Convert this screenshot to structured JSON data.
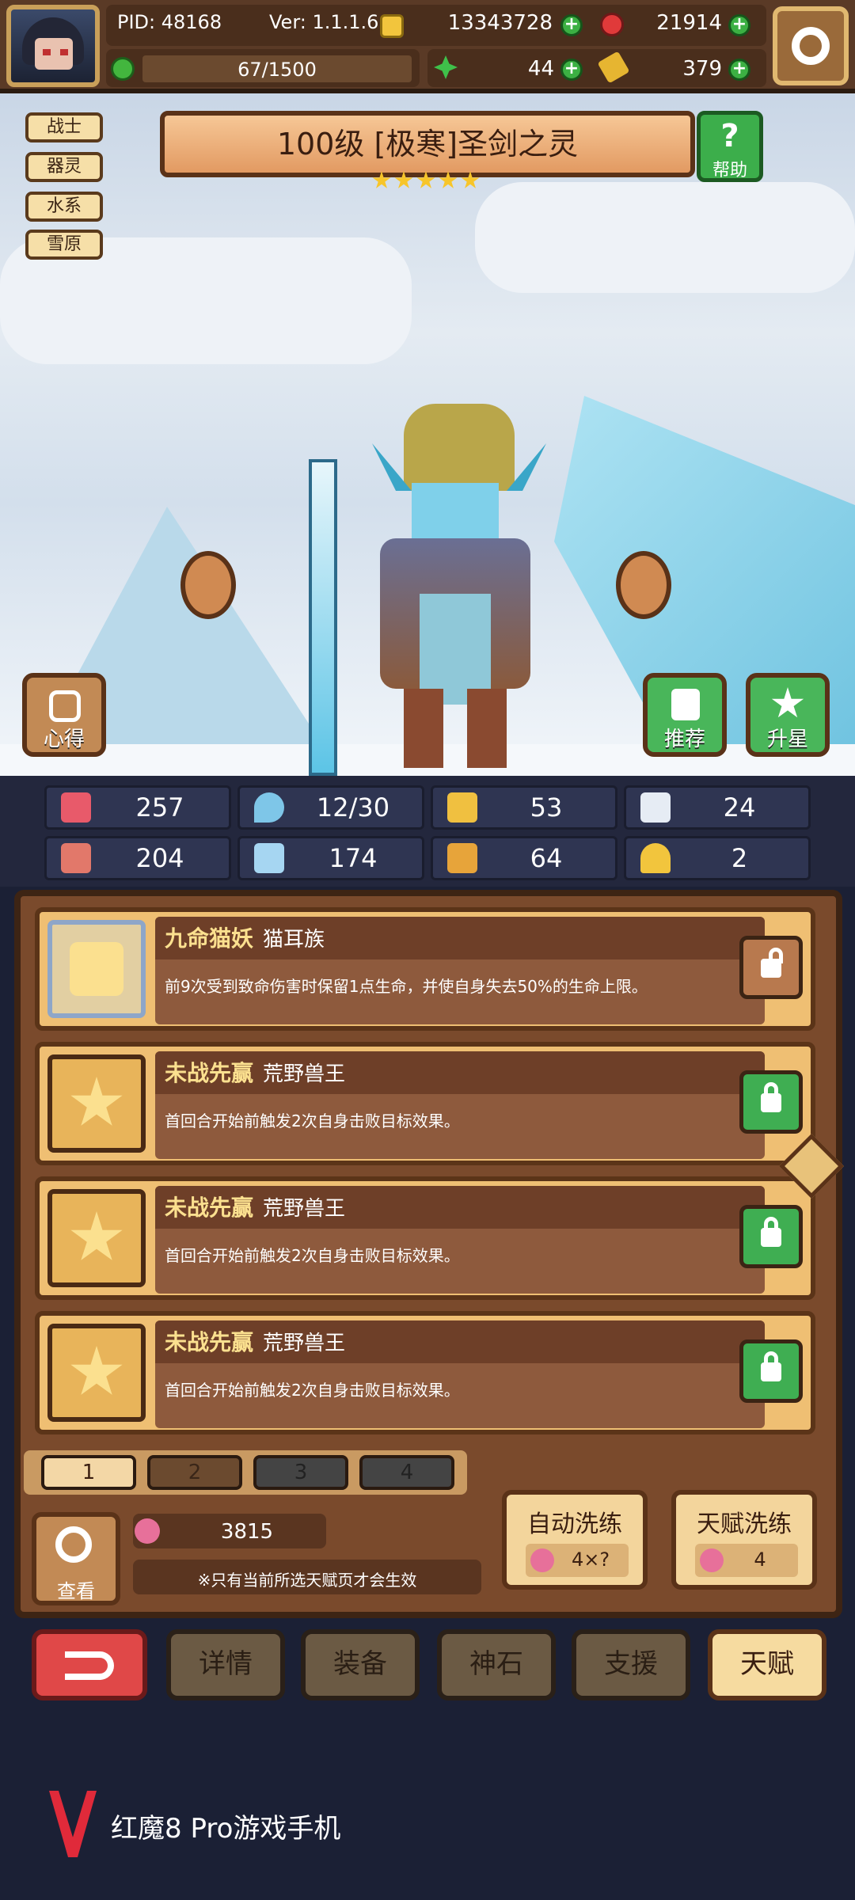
{
  "header": {
    "pid": "PID: 48168",
    "version": "Ver: 1.1.1.6",
    "gold": "13343728",
    "gems": "21914",
    "energy": "67/1500",
    "clover": "44",
    "key": "379"
  },
  "hero": {
    "title": "100级 [极寒]圣剑之灵",
    "stars": 5,
    "tags": [
      "战士",
      "器灵",
      "水系",
      "雪原"
    ],
    "help_label": "帮助",
    "notes_label": "心得",
    "recommend_label": "推荐",
    "starup_label": "升星"
  },
  "stats": [
    {
      "icon": "heart-icon",
      "value": "257"
    },
    {
      "icon": "droplet-icon",
      "value": "12/30"
    },
    {
      "icon": "shield-icon",
      "value": "53"
    },
    {
      "icon": "wing-icon",
      "value": "24"
    },
    {
      "icon": "fist-icon",
      "value": "204"
    },
    {
      "icon": "book-icon",
      "value": "174"
    },
    {
      "icon": "boot-icon",
      "value": "64"
    },
    {
      "icon": "horseshoe-icon",
      "value": "2"
    }
  ],
  "talents": [
    {
      "name": "九命猫妖",
      "race": "猫耳族",
      "desc": "前9次受到致命伤害时保留1点生命，并使自身失去50%的生命上限。",
      "locked": false
    },
    {
      "name": "未战先赢",
      "race": "荒野兽王",
      "desc": "首回合开始前触发2次自身击败目标效果。",
      "locked": true
    },
    {
      "name": "未战先赢",
      "race": "荒野兽王",
      "desc": "首回合开始前触发2次自身击败目标效果。",
      "locked": true
    },
    {
      "name": "未战先赢",
      "race": "荒野兽王",
      "desc": "首回合开始前触发2次自身击败目标效果。",
      "locked": true
    }
  ],
  "pages": [
    "1",
    "2",
    "3",
    "4"
  ],
  "bottom": {
    "view_label": "查看",
    "peach_count": "3815",
    "note": "※只有当前所选天赋页才会生效",
    "auto_refine_label": "自动洗练",
    "auto_refine_cost": "4×?",
    "talent_refine_label": "天赋洗练",
    "talent_refine_cost": "4"
  },
  "nav": [
    "详情",
    "装备",
    "神石",
    "支援",
    "天赋"
  ],
  "watermark": "红魔8 Pro游戏手机"
}
